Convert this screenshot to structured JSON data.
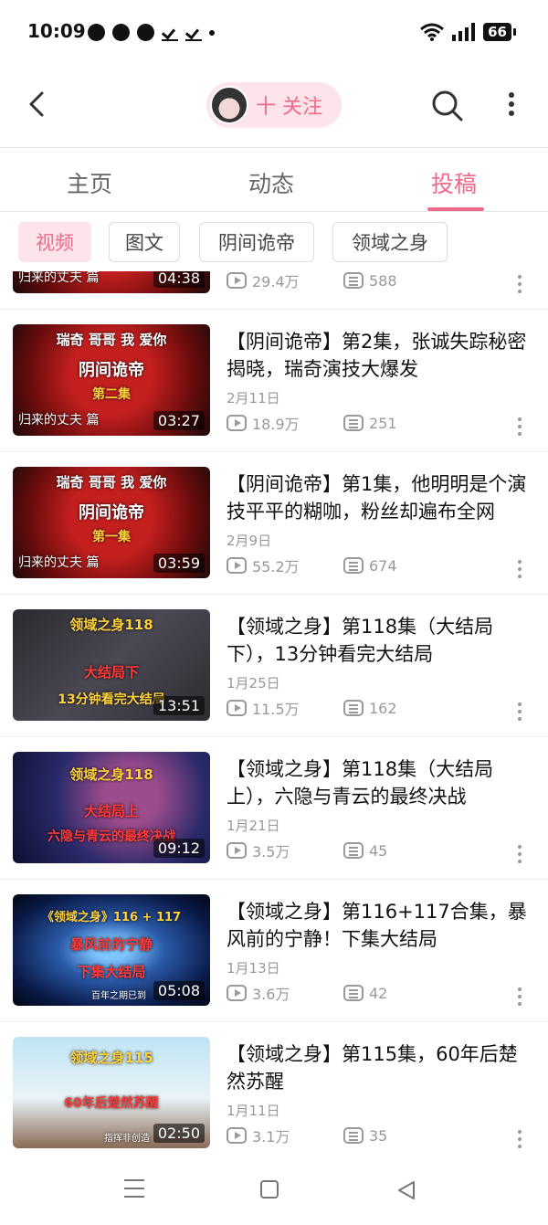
{
  "status_bar": {
    "time": "10:09",
    "battery": "66",
    "notification_icons": [
      "chrome-icon",
      "pinterest-icon",
      "weibo-icon",
      "check-icon",
      "check-icon",
      "dot-icon"
    ]
  },
  "header": {
    "follow_label": "十 关注"
  },
  "tabs": [
    {
      "label": "主页",
      "active": false
    },
    {
      "label": "动态",
      "active": false
    },
    {
      "label": "投稿",
      "active": true
    }
  ],
  "filters": [
    {
      "label": "视频",
      "active": true
    },
    {
      "label": "图文",
      "active": false
    },
    {
      "label": "阴间诡帝",
      "active": false
    },
    {
      "label": "领域之身",
      "active": false
    }
  ],
  "videos": [
    {
      "title": "",
      "date": "",
      "views": "29.4万",
      "danmaku": "588",
      "duration": "04:38",
      "thumb_lines": [
        "",
        "",
        "",
        "归来的丈夫 篇"
      ]
    },
    {
      "title": "【阴间诡帝】第2集，张诚失踪秘密揭晓，瑞奇演技大爆发",
      "date": "2月11日",
      "views": "18.9万",
      "danmaku": "251",
      "duration": "03:27",
      "thumb_lines": [
        "瑞奇 哥哥 我 爱你",
        "阴间诡帝",
        "第二集",
        "归来的丈夫 篇"
      ]
    },
    {
      "title": "【阴间诡帝】第1集，他明明是个演技平平的糊咖，粉丝却遍布全网",
      "date": "2月9日",
      "views": "55.2万",
      "danmaku": "674",
      "duration": "03:59",
      "thumb_lines": [
        "瑞奇 哥哥 我 爱你",
        "阴间诡帝",
        "第一集",
        "归来的丈夫 篇"
      ]
    },
    {
      "title": "【领域之身】第118集（大结局下），13分钟看完大结局",
      "date": "1月25日",
      "views": "11.5万",
      "danmaku": "162",
      "duration": "13:51",
      "thumb_lines": [
        "领域之身118",
        "大结局下",
        "13分钟看完大结局",
        ""
      ]
    },
    {
      "title": "【领域之身】第118集（大结局上），六隐与青云的最终决战",
      "date": "1月21日",
      "views": "3.5万",
      "danmaku": "45",
      "duration": "09:12",
      "thumb_lines": [
        "领域之身118",
        "大结局上",
        "六隐与青云的最终决战",
        ""
      ]
    },
    {
      "title": "【领域之身】第116+117合集，暴风前的宁静！下集大结局",
      "date": "1月13日",
      "views": "3.6万",
      "danmaku": "42",
      "duration": "05:08",
      "thumb_lines": [
        "《领域之身》116 + 117",
        "暴风前的宁静",
        "下集大结局",
        "百年之期已到"
      ]
    },
    {
      "title": "【领域之身】第115集，60年后楚然苏醒",
      "date": "1月11日",
      "views": "3.1万",
      "danmaku": "35",
      "duration": "02:50",
      "thumb_lines": [
        "领域之身115",
        "60年后楚然苏醒",
        "",
        "指挥非创造"
      ]
    }
  ]
}
